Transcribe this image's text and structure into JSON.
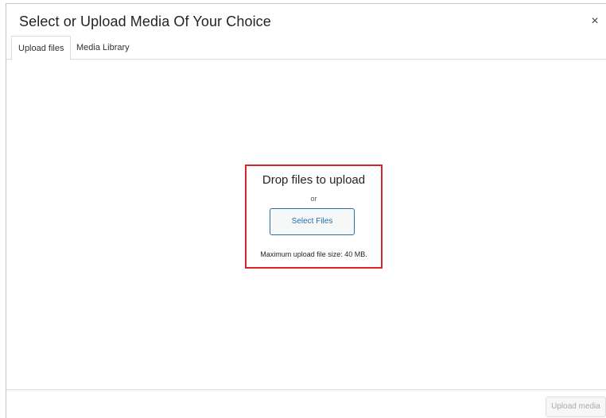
{
  "modal": {
    "title": "Select or Upload Media Of Your Choice",
    "close_icon": "×"
  },
  "tabs": [
    {
      "label": "Upload files",
      "active": true
    },
    {
      "label": "Media Library",
      "active": false
    }
  ],
  "uploader": {
    "drop_text": "Drop files to upload",
    "or_text": "or",
    "select_button": "Select Files",
    "max_size_text": "Maximum upload file size: 40 MB."
  },
  "footer": {
    "upload_media_button": "Upload media",
    "upload_media_disabled": true
  },
  "colors": {
    "accent": "#2271b1",
    "highlight": "#d9222a",
    "disabled_text": "#a7aaad"
  }
}
